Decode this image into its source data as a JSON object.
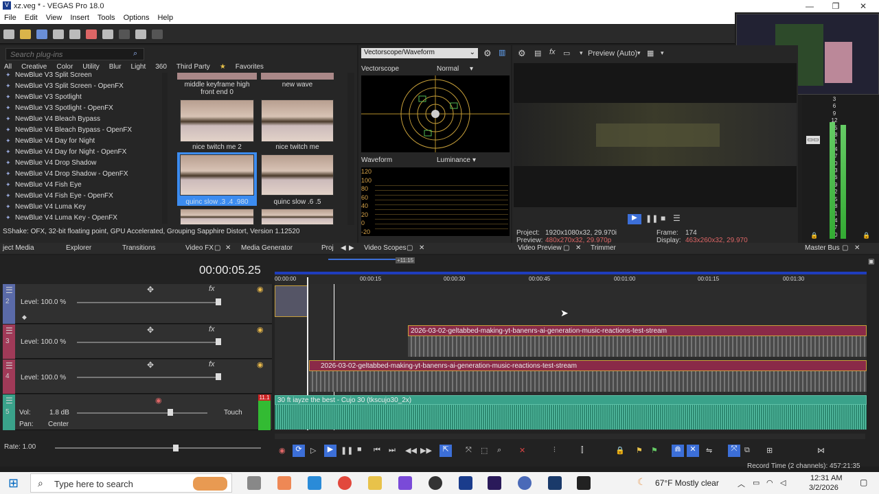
{
  "window": {
    "title": "xz.veg * - VEGAS Pro 18.0"
  },
  "menu": [
    "File",
    "Edit",
    "View",
    "Insert",
    "Tools",
    "Options",
    "Help"
  ],
  "plugins": {
    "search_placeholder": "Search plug-ins",
    "categories": [
      "All",
      "Creative",
      "Color",
      "Utility",
      "Blur",
      "Light",
      "360",
      "Third Party",
      "Favorites"
    ],
    "list": [
      "NewBlue V3 Split Screen",
      "NewBlue V3 Split Screen - OpenFX",
      "NewBlue V3 Spotlight",
      "NewBlue V3 Spotlight - OpenFX",
      "NewBlue V4 Bleach Bypass",
      "NewBlue V4 Bleach Bypass - OpenFX",
      "NewBlue V4 Day for Night",
      "NewBlue V4 Day for Night - OpenFX",
      "NewBlue V4 Drop Shadow",
      "NewBlue V4 Drop Shadow - OpenFX",
      "NewBlue V4 Fish Eye",
      "NewBlue V4 Fish Eye - OpenFX",
      "NewBlue V4 Luma Key",
      "NewBlue V4 Luma Key - OpenFX"
    ],
    "presets": {
      "p1": "middle keyframe high front end 0",
      "p2": "new wave",
      "p3": "nice twitch me 2",
      "p4": "nice twitch me",
      "p5": "quinc slow .3 .4 .980",
      "p6": "quinc slow .6 .5"
    },
    "status": "SShake: OFX, 32-bit floating point, GPU Accelerated, Grouping Sapphire Distort, Version 1.12520"
  },
  "dock_tabs": {
    "t1": "ject Media",
    "t2": "Explorer",
    "t3": "Transitions",
    "t4": "Video FX",
    "t5": "Media Generator",
    "t6": "Proj",
    "t7": "Video Scopes",
    "t8": "Video Preview",
    "t9": "Trimmer",
    "t10": "Master Bus"
  },
  "scopes": {
    "selector": "Vectorscope/Waveform",
    "vectorscope": "Vectorscope",
    "mode1": "Normal",
    "waveform": "Waveform",
    "mode2": "Luminance",
    "ticks": [
      "120",
      "100",
      "80",
      "60",
      "40",
      "20",
      "0",
      "-20"
    ]
  },
  "preview": {
    "mode": "Preview (Auto)",
    "project_label": "Project:",
    "project": "1920x1080x32, 29.970i",
    "preview_label": "Preview:",
    "preview_val": "480x270x32, 29.970p",
    "frame_label": "Frame:",
    "frame": "174",
    "display_label": "Display:",
    "display": "463x260x32, 29.970"
  },
  "meter": {
    "ticks": [
      "3",
      "6",
      "9",
      "12",
      "15",
      "18",
      "21",
      "24",
      "27",
      "30",
      "33",
      "36",
      "39",
      "42",
      "45",
      "48",
      "51",
      "54",
      "57",
      "60"
    ]
  },
  "timeline": {
    "timecode": "00:00:05.25",
    "offset": "+11:15",
    "ruler": [
      "00:00:00",
      "00:00:15",
      "00:00:30",
      "00:00:45",
      "00:01:00",
      "00:01:15",
      "00:01:30"
    ],
    "tracks": [
      {
        "num": "2",
        "level": "Level: 100.0 %"
      },
      {
        "num": "3",
        "level": "Level: 100.0 %"
      },
      {
        "num": "4",
        "level": "Level: 100.0 %"
      }
    ],
    "audio": {
      "num": "5",
      "vol_label": "Vol:",
      "vol": "1.8 dB",
      "pan_label": "Pan:",
      "pan": "Center",
      "touch": "Touch",
      "peak": "11.1"
    },
    "clip1": "2026-03-02-geltabbed-making-yt-banenrs-ai-generation-music-reactions-test-stream",
    "clip2": "2026-03-02-geltabbed-making-yt-banenrs-ai-generation-music-reactions-test-stream",
    "audio_clip": "30 ft iayze the best - Cujo 30 (tkscujo30_2x)",
    "rate": "Rate: 1.00",
    "record_time": "Record Time (2 channels): 457:21:35"
  },
  "taskbar": {
    "search": "Type here to search",
    "weather": "67°F  Mostly clear",
    "time": "12:31 AM",
    "date": "3/2/2026"
  },
  "colors": {
    "accent": "#3c6fd8",
    "clip": "#8a2a48",
    "audio": "#3aa28a"
  }
}
